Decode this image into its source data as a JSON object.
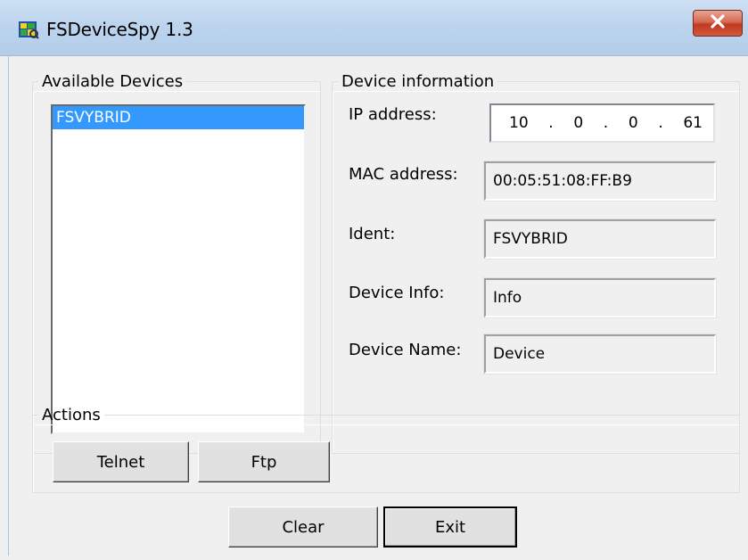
{
  "window": {
    "title": "FSDeviceSpy 1.3",
    "icon": "app-icon",
    "close_icon": "close-icon"
  },
  "available_devices": {
    "legend": "Available Devices",
    "items": [
      {
        "label": "FSVYBRID",
        "selected": true
      }
    ]
  },
  "device_info": {
    "legend": "Device information",
    "ip_label": "IP address:",
    "ip_octets": [
      "10",
      ".",
      "0",
      ".",
      "0",
      ".",
      "61"
    ],
    "mac_label": "MAC address:",
    "mac_value": "00:05:51:08:FF:B9",
    "ident_label": "Ident:",
    "ident_value": "FSVYBRID",
    "info_label": "Device Info:",
    "info_value": "Info",
    "name_label": "Device Name:",
    "name_value": "Device"
  },
  "actions": {
    "legend": "Actions",
    "telnet_label": "Telnet",
    "ftp_label": "Ftp"
  },
  "footer": {
    "clear_label": "Clear",
    "exit_label": "Exit"
  },
  "colors": {
    "selection": "#3399ff",
    "close_button": "#c2391f",
    "titlebar": "#bcd4ee"
  }
}
